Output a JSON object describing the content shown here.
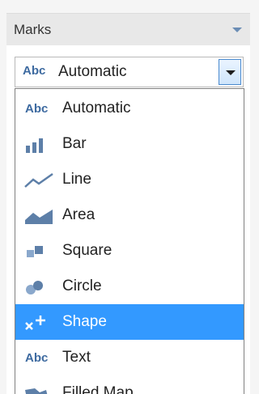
{
  "marks_panel": {
    "title": "Marks",
    "selected_value": "Automatic",
    "selected_icon": "abc-icon"
  },
  "dropdown": {
    "options": [
      {
        "label": "Automatic",
        "icon": "abc-icon",
        "selected": false
      },
      {
        "label": "Bar",
        "icon": "bar-chart-icon",
        "selected": false
      },
      {
        "label": "Line",
        "icon": "line-chart-icon",
        "selected": false
      },
      {
        "label": "Area",
        "icon": "area-chart-icon",
        "selected": false
      },
      {
        "label": "Square",
        "icon": "square-icon",
        "selected": false
      },
      {
        "label": "Circle",
        "icon": "circle-icon",
        "selected": false
      },
      {
        "label": "Shape",
        "icon": "shape-icon",
        "selected": true
      },
      {
        "label": "Text",
        "icon": "abc-icon",
        "selected": false
      },
      {
        "label": "Filled Map",
        "icon": "filled-map-icon",
        "selected": false
      }
    ]
  },
  "colors": {
    "highlight": "#3399ff",
    "icon_blue": "#3d6aa0"
  }
}
